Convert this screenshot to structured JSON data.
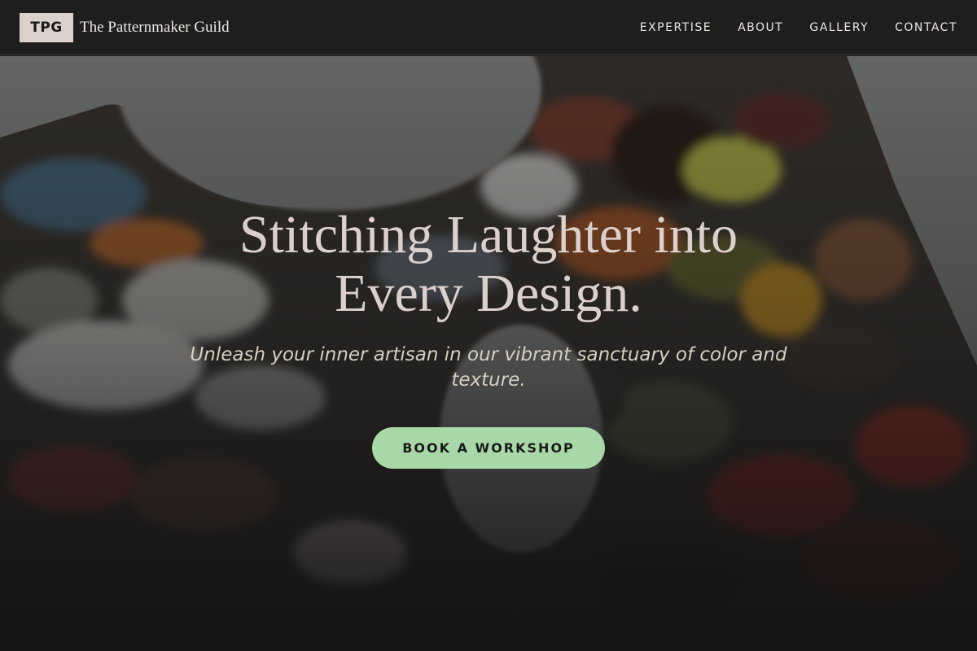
{
  "header": {
    "logo_text": "TPG",
    "brand_name": "The Patternmaker Guild",
    "nav": [
      {
        "label": "EXPERTISE"
      },
      {
        "label": "ABOUT"
      },
      {
        "label": "GALLERY"
      },
      {
        "label": "CONTACT"
      }
    ]
  },
  "hero": {
    "headline": "Stitching Laughter into Every Design.",
    "subtitle": "Unleash your inner artisan in our vibrant sanctuary of color and texture.",
    "cta_label": "BOOK A WORKSHOP",
    "background_image": "paint-palette-photo"
  },
  "colors": {
    "header_bg": "#1e1e1e",
    "logo_bg": "#dcd0cc",
    "headline": "#dcd0cc",
    "subtitle": "#d6cfc0",
    "cta_bg": "#a8d8a8",
    "cta_text": "#1a1a1a"
  }
}
